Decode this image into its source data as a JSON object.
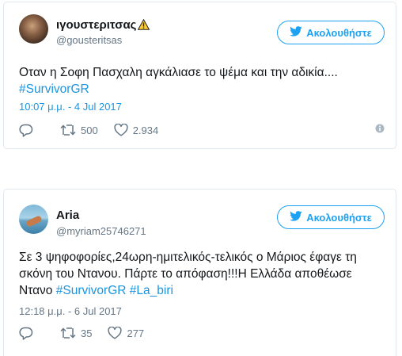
{
  "tweets": [
    {
      "name": "ιγουστεριτσας",
      "handle": "@gousteritsas",
      "follow_label": "Ακολουθήστε",
      "text_plain": "Οταν η Σοφη Πασχαλη αγκάλιασε το ψέμα και την αδικία....",
      "hashtags": [
        "#SurvivorGR"
      ],
      "date": "10:07 μ.μ. - 4 Jul 2017",
      "retweets": "500",
      "likes": "2.934"
    },
    {
      "name": "Aria",
      "handle": "@myriam25746271",
      "follow_label": "Ακολουθήστε",
      "text_line1": "Σε 3 ψηφοφορίες,24ωρη-ημιτελικός-τελικός ο Μάριος έφαγε τη",
      "text_line2": "σκόνη του Ντανου. Πάρτε το απόφαση!!!Η Ελλάδα αποθέωσε",
      "text_line3_prefix": "Ντανο ",
      "hashtags": [
        "#SurvivorGR",
        "#La_biri"
      ],
      "date": "12:18 μ.μ. - 6 Jul 2017",
      "retweets": "35",
      "likes": "277"
    }
  ],
  "colors": {
    "accent": "#1da1f2",
    "link": "#1b95e0",
    "muted": "#657786",
    "border": "#e1e8ed"
  },
  "icons": [
    "warning-icon",
    "twitter-bird-icon",
    "reply-icon",
    "retweet-icon",
    "like-icon",
    "info-icon"
  ]
}
